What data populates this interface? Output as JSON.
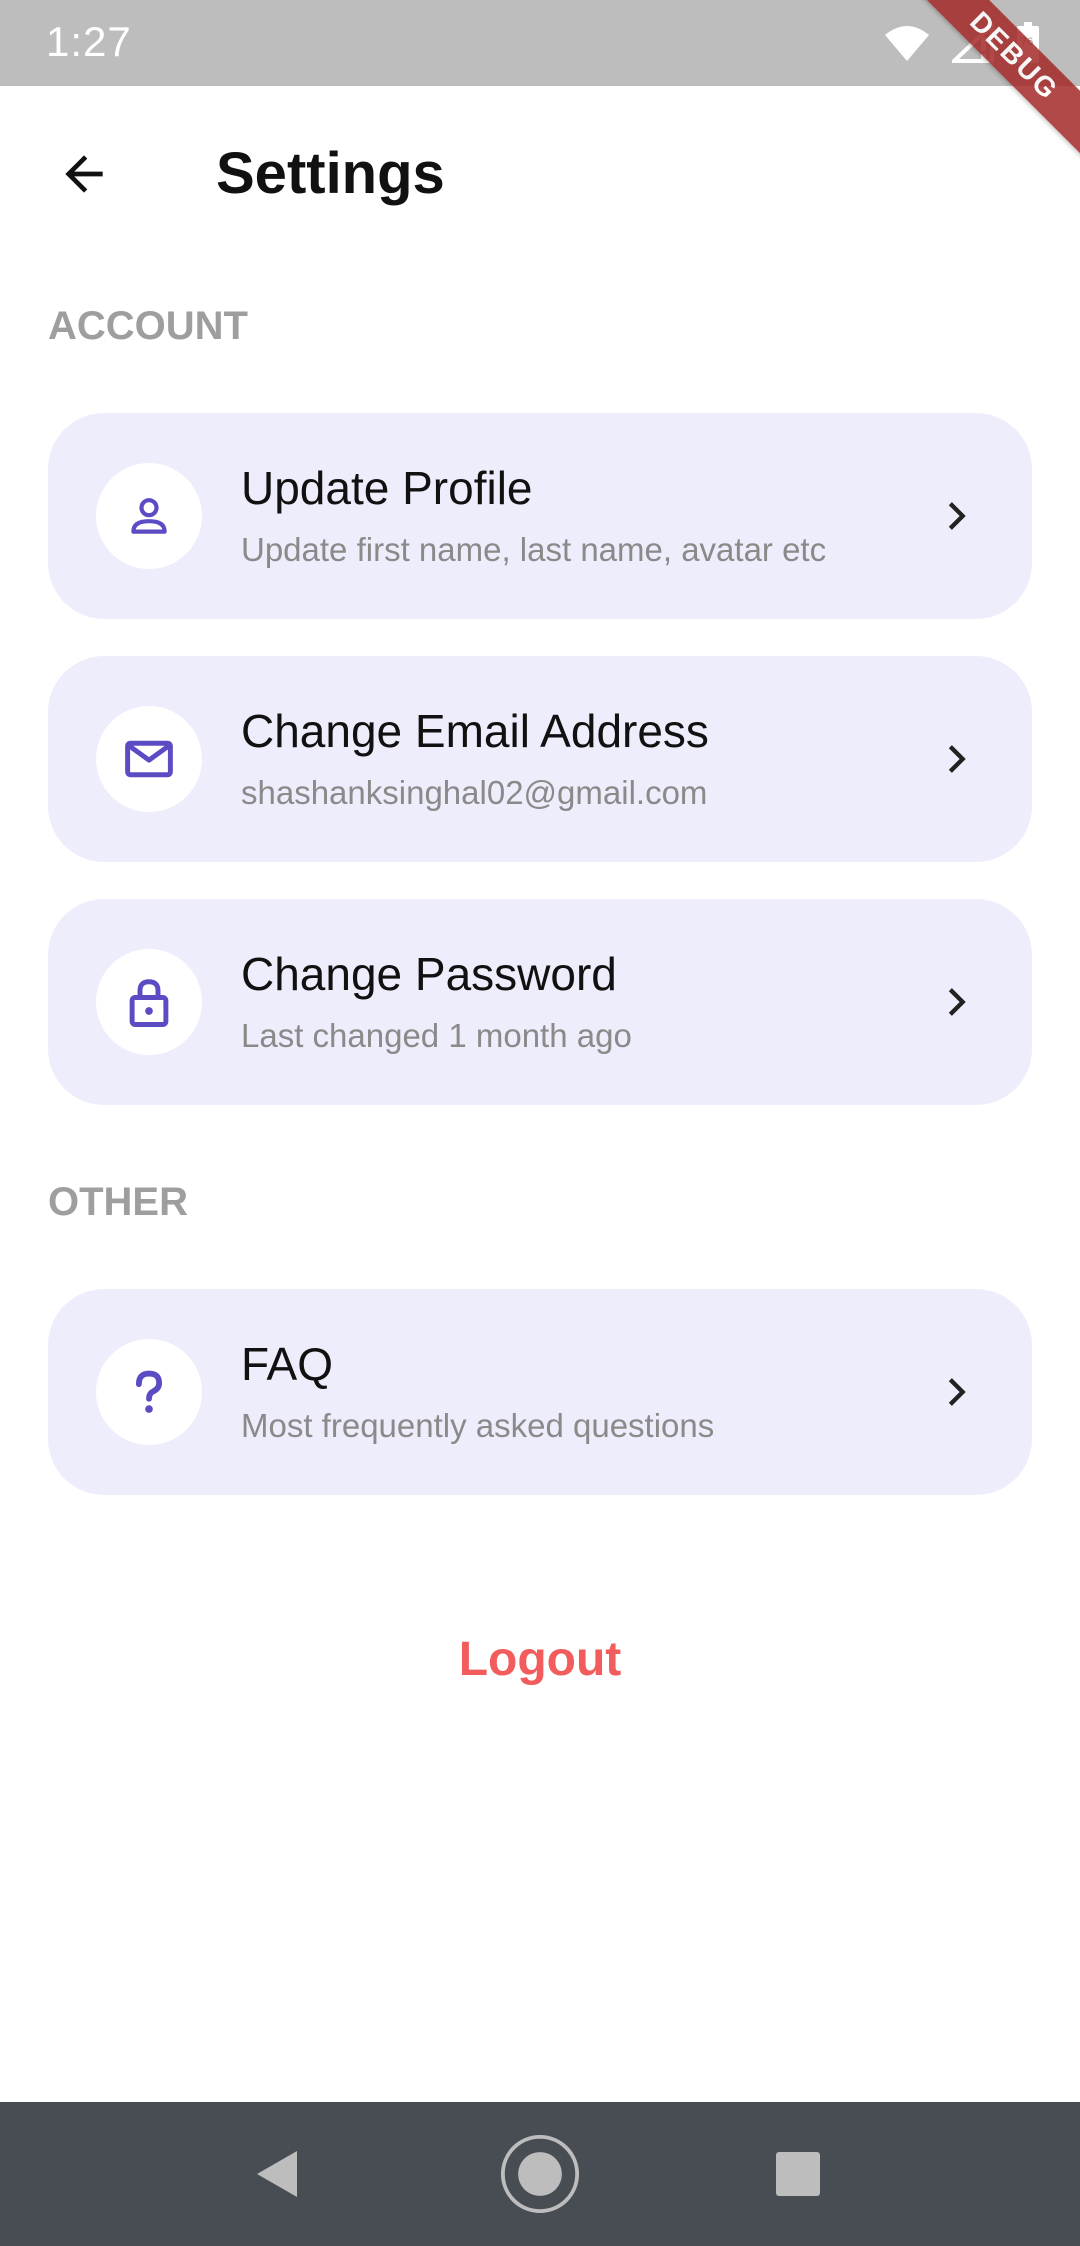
{
  "status_bar": {
    "time": "1:27",
    "battery_level": "76",
    "debug_label": "DEBUG"
  },
  "app_bar": {
    "title": "Settings",
    "back_icon": "arrow-left-icon"
  },
  "sections": [
    {
      "header": "ACCOUNT",
      "items": [
        {
          "title": "Update Profile",
          "subtitle": "Update first name, last name, avatar etc",
          "icon": "person-icon"
        },
        {
          "title": "Change Email Address",
          "subtitle": "shashanksinghal02@gmail.com",
          "icon": "mail-icon"
        },
        {
          "title": "Change Password",
          "subtitle": "Last changed 1 month ago",
          "icon": "lock-icon"
        }
      ]
    },
    {
      "header": "OTHER",
      "items": [
        {
          "title": "FAQ",
          "subtitle": "Most frequently asked questions",
          "icon": "question-icon"
        }
      ]
    }
  ],
  "logout_label": "Logout",
  "colors": {
    "accent": "#5b4cc4",
    "card_background": "#eeedfb",
    "logout": "#f25c5c",
    "section_header": "#9e9e9e",
    "status_bar": "#bdbdbd",
    "nav_bar": "#474d53"
  },
  "nav_bar": {
    "back_icon": "triangle-back-icon",
    "home_icon": "circle-home-icon",
    "recents_icon": "square-recents-icon"
  }
}
